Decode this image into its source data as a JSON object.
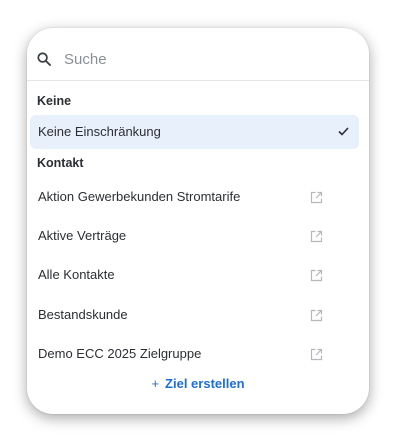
{
  "search": {
    "placeholder": "Suche",
    "icon": "search-icon"
  },
  "groups": [
    {
      "header": "Keine",
      "options": [
        {
          "label": "Keine Einschränkung",
          "selected": true,
          "icon": "check-icon"
        }
      ]
    },
    {
      "header": "Kontakt",
      "options": [
        {
          "label": "Aktion Gewerbekunden Stromtarife",
          "icon": "external-link-icon"
        },
        {
          "label": "Aktive Verträge",
          "icon": "external-link-icon"
        },
        {
          "label": "Alle Kontakte",
          "icon": "external-link-icon"
        },
        {
          "label": "Bestandskunde",
          "icon": "external-link-icon"
        },
        {
          "label": "Demo ECC 2025 Zielgruppe",
          "icon": "external-link-icon"
        }
      ]
    }
  ],
  "footer": {
    "create_label": "Ziel erstellen",
    "create_icon": "plus-icon"
  },
  "colors": {
    "accent": "#1f6fd1",
    "selected_bg": "#e8f0fc"
  }
}
